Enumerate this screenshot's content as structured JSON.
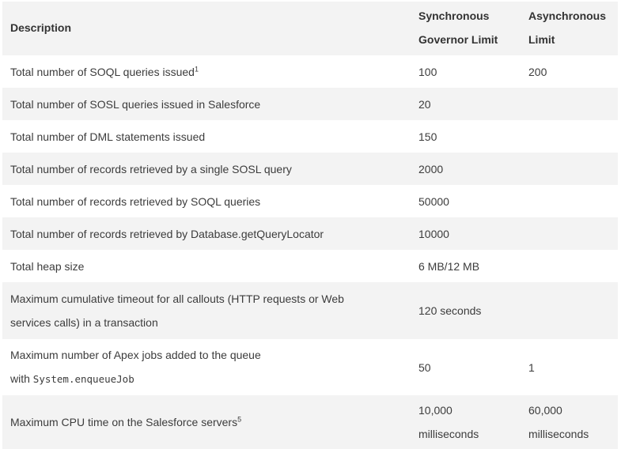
{
  "table": {
    "headers": {
      "description": "Description",
      "synchronous_line1": "Synchronous",
      "synchronous_line2": "Governor Limit",
      "asynchronous_line1": "Asynchronous",
      "asynchronous_line2": "Limit"
    },
    "rows": [
      {
        "description": "Total number of SOQL queries issued",
        "footnote": "1",
        "sync": "100",
        "async": "200"
      },
      {
        "description": "Total number of SOSL queries issued in Salesforce",
        "sync": "20",
        "async": ""
      },
      {
        "description": "Total number of DML statements issued",
        "sync": "150",
        "async": ""
      },
      {
        "description": "Total number of records retrieved by a single SOSL query",
        "sync": "2000",
        "async": ""
      },
      {
        "description": "Total number of records retrieved by SOQL queries",
        "sync": "50000",
        "async": ""
      },
      {
        "description": "Total number of records retrieved by Database.getQueryLocator",
        "sync": "10000",
        "async": ""
      },
      {
        "description": "Total heap size",
        "sync": "6 MB/12 MB",
        "async": ""
      },
      {
        "description_line1": "Maximum cumulative timeout for all callouts (HTTP requests or Web",
        "description_line2": "services calls) in a transaction",
        "sync": "120 seconds",
        "async": ""
      },
      {
        "description_line1": "Maximum number of Apex jobs added to the queue",
        "description_line2_prefix": "with",
        "description_code": "System.enqueueJob",
        "sync": "50",
        "async": "1"
      },
      {
        "description": "Maximum CPU time on the Salesforce servers",
        "footnote": "5",
        "sync_line1": "10,000",
        "sync_line2": "milliseconds",
        "async_line1": "60,000",
        "async_line2": "milliseconds"
      }
    ]
  }
}
